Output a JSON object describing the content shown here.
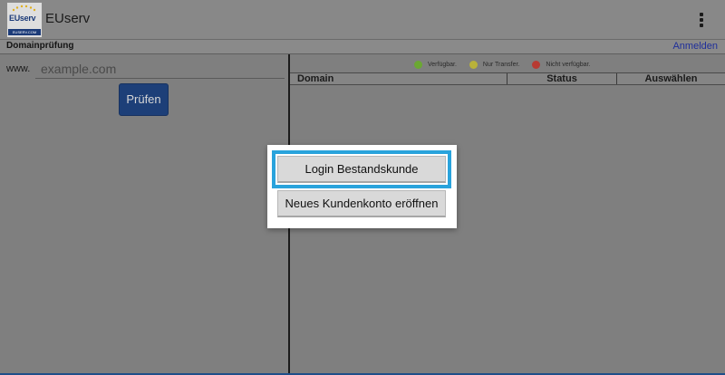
{
  "app": {
    "title": "EUserv",
    "logo_text": "EUserv",
    "logo_strip": "EUSERV.COM"
  },
  "section": {
    "title": "Domainprüfung",
    "login_link": "Anmelden"
  },
  "domain_check": {
    "prefix": "www.",
    "placeholder": "example.com",
    "value": "",
    "check_button": "Prüfen"
  },
  "legend": [
    {
      "label": "Verfügbar.",
      "color": "#6ba832"
    },
    {
      "label": "Nur Transfer.",
      "color": "#b9b23a"
    },
    {
      "label": "Nicht verfügbar.",
      "color": "#b73b33"
    }
  ],
  "table": {
    "columns": [
      "Domain",
      "Status",
      "Auswählen"
    ]
  },
  "dialog": {
    "login_button": "Login Bestandskunde",
    "new_account_button": "Neues Kundenkonto eröffnen"
  },
  "colors": {
    "accent_focus": "#29a3dc",
    "button_blue": "#1d3f78",
    "link_blue": "#1f2f9a"
  }
}
